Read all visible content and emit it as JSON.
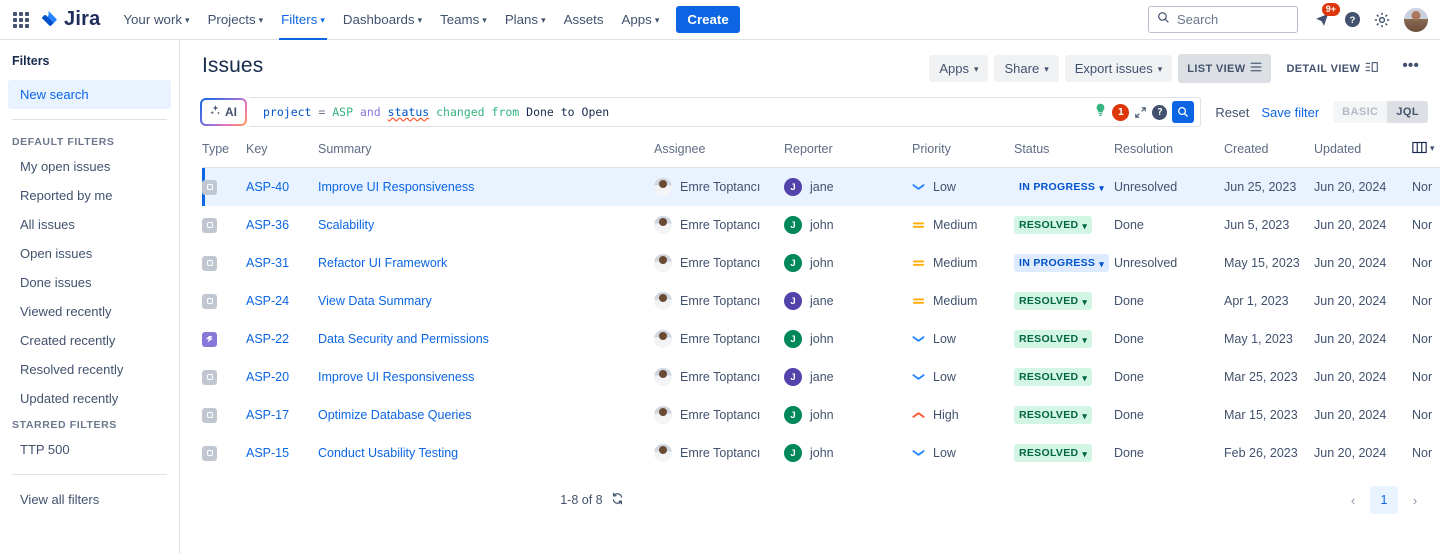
{
  "topnav": {
    "apps_icon": "apps-grid-icon",
    "logo_text": "Jira",
    "items": [
      {
        "label": "Your work",
        "has_caret": true,
        "active": false
      },
      {
        "label": "Projects",
        "has_caret": true,
        "active": false
      },
      {
        "label": "Filters",
        "has_caret": true,
        "active": true
      },
      {
        "label": "Dashboards",
        "has_caret": true,
        "active": false
      },
      {
        "label": "Teams",
        "has_caret": true,
        "active": false
      },
      {
        "label": "Plans",
        "has_caret": true,
        "active": false
      },
      {
        "label": "Assets",
        "has_caret": false,
        "active": false
      },
      {
        "label": "Apps",
        "has_caret": true,
        "active": false
      }
    ],
    "create_label": "Create",
    "search_placeholder": "Search",
    "notification_badge": "9+",
    "icons": [
      "search-icon",
      "notifications-icon",
      "help-icon",
      "settings-icon",
      "profile-avatar"
    ]
  },
  "sidebar": {
    "title": "Filters",
    "selected": {
      "label": "New search"
    },
    "default_filters_heading": "DEFAULT FILTERS",
    "default_filters": [
      {
        "label": "My open issues"
      },
      {
        "label": "Reported by me"
      },
      {
        "label": "All issues"
      },
      {
        "label": "Open issues"
      },
      {
        "label": "Done issues"
      },
      {
        "label": "Viewed recently"
      },
      {
        "label": "Created recently"
      },
      {
        "label": "Resolved recently"
      },
      {
        "label": "Updated recently"
      }
    ],
    "starred_filters_heading": "STARRED FILTERS",
    "starred_filters": [
      {
        "label": "TTP 500"
      }
    ],
    "view_all": "View all filters"
  },
  "main": {
    "page_title": "Issues",
    "toolbar": {
      "apps_label": "Apps",
      "share_label": "Share",
      "export_label": "Export issues",
      "list_view_label": "LIST VIEW",
      "detail_view_label": "DETAIL VIEW",
      "more_label": "•••"
    },
    "jql": {
      "ai_label": "AI",
      "ai_icon": "ai-sparkle-icon",
      "query_raw": "project = ASP and status changed from Done to Open",
      "tokens": [
        {
          "text": "project",
          "kind": "field"
        },
        {
          "text": " = ",
          "kind": "op"
        },
        {
          "text": "ASP",
          "kind": "value"
        },
        {
          "text": " and ",
          "kind": "keyword"
        },
        {
          "text": "status",
          "kind": "error"
        },
        {
          "text": " changed from ",
          "kind": "function"
        },
        {
          "text": "Done to Open",
          "kind": "text"
        }
      ],
      "hint_icon": "lightbulb-icon",
      "error_count": "1",
      "expand_icon": "expand-icon",
      "help_icon": "help-circle-icon",
      "search_icon": "search-icon",
      "reset_label": "Reset",
      "save_filter_label": "Save filter",
      "mode_basic": "BASIC",
      "mode_jql": "JQL",
      "mode_selected": "JQL"
    },
    "table": {
      "columns": [
        "Type",
        "Key",
        "Summary",
        "Assignee",
        "Reporter",
        "Priority",
        "Status",
        "Resolution",
        "Created",
        "Updated",
        "Nor"
      ],
      "config_icon": "columns-config-icon",
      "rows": [
        {
          "type_icon": "task-icon",
          "type_kind": "task",
          "key": "ASP-40",
          "summary": "Improve UI Responsiveness",
          "assignee": "Emre Toptancı",
          "reporter": "jane",
          "reporter_initial": "J",
          "reporter_color": "#5243aa",
          "priority": "Low",
          "priority_kind": "low",
          "status": "IN PROGRESS",
          "status_kind": "inprogress_plain",
          "resolution": "Unresolved",
          "created": "Jun 25, 2023",
          "updated": "Jun 20, 2024",
          "extra": "Nor",
          "selected": true
        },
        {
          "type_icon": "task-icon",
          "type_kind": "task",
          "key": "ASP-36",
          "summary": "Scalability",
          "assignee": "Emre Toptancı",
          "reporter": "john",
          "reporter_initial": "J",
          "reporter_color": "#00875a",
          "priority": "Medium",
          "priority_kind": "medium",
          "status": "RESOLVED",
          "status_kind": "resolved",
          "resolution": "Done",
          "created": "Jun 5, 2023",
          "updated": "Jun 20, 2024",
          "extra": "Nor",
          "selected": false
        },
        {
          "type_icon": "task-icon",
          "type_kind": "task",
          "key": "ASP-31",
          "summary": "Refactor UI Framework",
          "assignee": "Emre Toptancı",
          "reporter": "john",
          "reporter_initial": "J",
          "reporter_color": "#00875a",
          "priority": "Medium",
          "priority_kind": "medium",
          "status": "IN PROGRESS",
          "status_kind": "inprogress",
          "resolution": "Unresolved",
          "created": "May 15, 2023",
          "updated": "Jun 20, 2024",
          "extra": "Nor",
          "selected": false
        },
        {
          "type_icon": "task-icon",
          "type_kind": "task",
          "key": "ASP-24",
          "summary": "View Data Summary",
          "assignee": "Emre Toptancı",
          "reporter": "jane",
          "reporter_initial": "J",
          "reporter_color": "#5243aa",
          "priority": "Medium",
          "priority_kind": "medium",
          "status": "RESOLVED",
          "status_kind": "resolved",
          "resolution": "Done",
          "created": "Apr 1, 2023",
          "updated": "Jun 20, 2024",
          "extra": "Nor",
          "selected": false
        },
        {
          "type_icon": "story-icon",
          "type_kind": "story",
          "key": "ASP-22",
          "summary": "Data Security and Permissions",
          "assignee": "Emre Toptancı",
          "reporter": "john",
          "reporter_initial": "J",
          "reporter_color": "#00875a",
          "priority": "Low",
          "priority_kind": "low",
          "status": "RESOLVED",
          "status_kind": "resolved",
          "resolution": "Done",
          "created": "May 1, 2023",
          "updated": "Jun 20, 2024",
          "extra": "Nor",
          "selected": false
        },
        {
          "type_icon": "task-icon",
          "type_kind": "task",
          "key": "ASP-20",
          "summary": "Improve UI Responsiveness",
          "assignee": "Emre Toptancı",
          "reporter": "jane",
          "reporter_initial": "J",
          "reporter_color": "#5243aa",
          "priority": "Low",
          "priority_kind": "low",
          "status": "RESOLVED",
          "status_kind": "resolved",
          "resolution": "Done",
          "created": "Mar 25, 2023",
          "updated": "Jun 20, 2024",
          "extra": "Nor",
          "selected": false
        },
        {
          "type_icon": "task-icon",
          "type_kind": "task",
          "key": "ASP-17",
          "summary": "Optimize Database Queries",
          "assignee": "Emre Toptancı",
          "reporter": "john",
          "reporter_initial": "J",
          "reporter_color": "#00875a",
          "priority": "High",
          "priority_kind": "high",
          "status": "RESOLVED",
          "status_kind": "resolved",
          "resolution": "Done",
          "created": "Mar 15, 2023",
          "updated": "Jun 20, 2024",
          "extra": "Nor",
          "selected": false
        },
        {
          "type_icon": "task-icon",
          "type_kind": "task",
          "key": "ASP-15",
          "summary": "Conduct Usability Testing",
          "assignee": "Emre Toptancı",
          "reporter": "john",
          "reporter_initial": "J",
          "reporter_color": "#00875a",
          "priority": "Low",
          "priority_kind": "low",
          "status": "RESOLVED",
          "status_kind": "resolved",
          "resolution": "Done",
          "created": "Feb 26, 2023",
          "updated": "Jun 20, 2024",
          "extra": "Nor",
          "selected": false
        }
      ]
    },
    "pager": {
      "range_label": "1-8 of 8",
      "refresh_icon": "refresh-icon",
      "prev_icon": "chevron-left-icon",
      "next_icon": "chevron-right-icon",
      "current_page": "1"
    }
  },
  "colors": {
    "brand_blue": "#0c66e4",
    "selected_row": "#e9f2ff",
    "status_green_bg": "#d3f5e4",
    "status_green_fg": "#006644",
    "status_blue_bg": "#deebff",
    "status_blue_fg": "#0052cc",
    "badge_red": "#de350b",
    "priority_low": "#2684ff",
    "priority_medium": "#ffab00",
    "priority_high": "#ff5630"
  }
}
